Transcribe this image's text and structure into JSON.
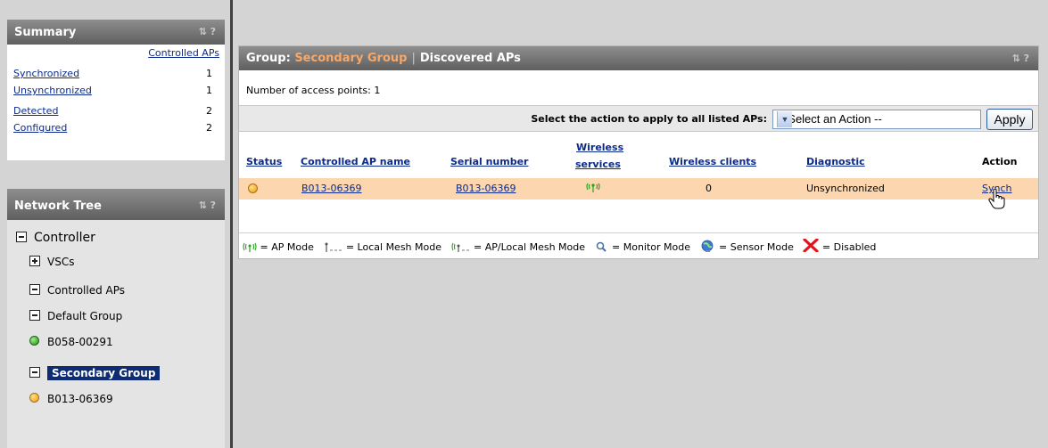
{
  "summary": {
    "title": "Summary",
    "tools": "⇅ ?",
    "column_header": "Controlled APs",
    "rows": [
      {
        "label": "Synchronized",
        "value": "1"
      },
      {
        "label": "Unsynchronized",
        "value": "1"
      },
      {
        "label": "Detected",
        "value": "2"
      },
      {
        "label": "Configured",
        "value": "2"
      }
    ]
  },
  "network_tree": {
    "title": "Network Tree",
    "tools": "⇅ ?",
    "items": [
      {
        "label": "Controller"
      },
      {
        "label": "VSCs"
      },
      {
        "label": "Controlled APs"
      },
      {
        "label": "Default Group"
      },
      {
        "label": "B058-00291"
      },
      {
        "label": "Secondary Group"
      },
      {
        "label": "B013-06369"
      }
    ]
  },
  "main": {
    "group_prefix": "Group:",
    "group_name": "Secondary Group",
    "separator": "|",
    "section": "Discovered APs",
    "tools": "⇅ ?",
    "ap_count_text": "Number of access points: 1",
    "action_label": "Select the action to apply to all listed APs:",
    "action_select_value": "-- Select an Action --",
    "apply_label": "Apply",
    "columns": {
      "status": "Status",
      "name": "Controlled AP name",
      "serial": "Serial number",
      "wireless_services_1": "Wireless",
      "wireless_services_2": "services",
      "wireless_clients": "Wireless clients",
      "diagnostic": "Diagnostic",
      "action": "Action"
    },
    "row": {
      "name": "B013-06369",
      "serial": "B013-06369",
      "clients": "0",
      "diagnostic": "Unsynchronized",
      "action": "Synch"
    },
    "legend": {
      "ap_mode": "= AP Mode",
      "local_mesh": "= Local Mesh Mode",
      "ap_local_mesh": "= AP/Local Mesh Mode",
      "monitor": "= Monitor Mode",
      "sensor": "= Sensor Mode",
      "disabled": "= Disabled"
    }
  },
  "colors": {
    "header_bar": "#6e6e6e",
    "group_name": "#f7a868",
    "row_highlight": "#fcd6ae",
    "selected_tree": "#0e2c73",
    "link": "#0b2a8c"
  }
}
